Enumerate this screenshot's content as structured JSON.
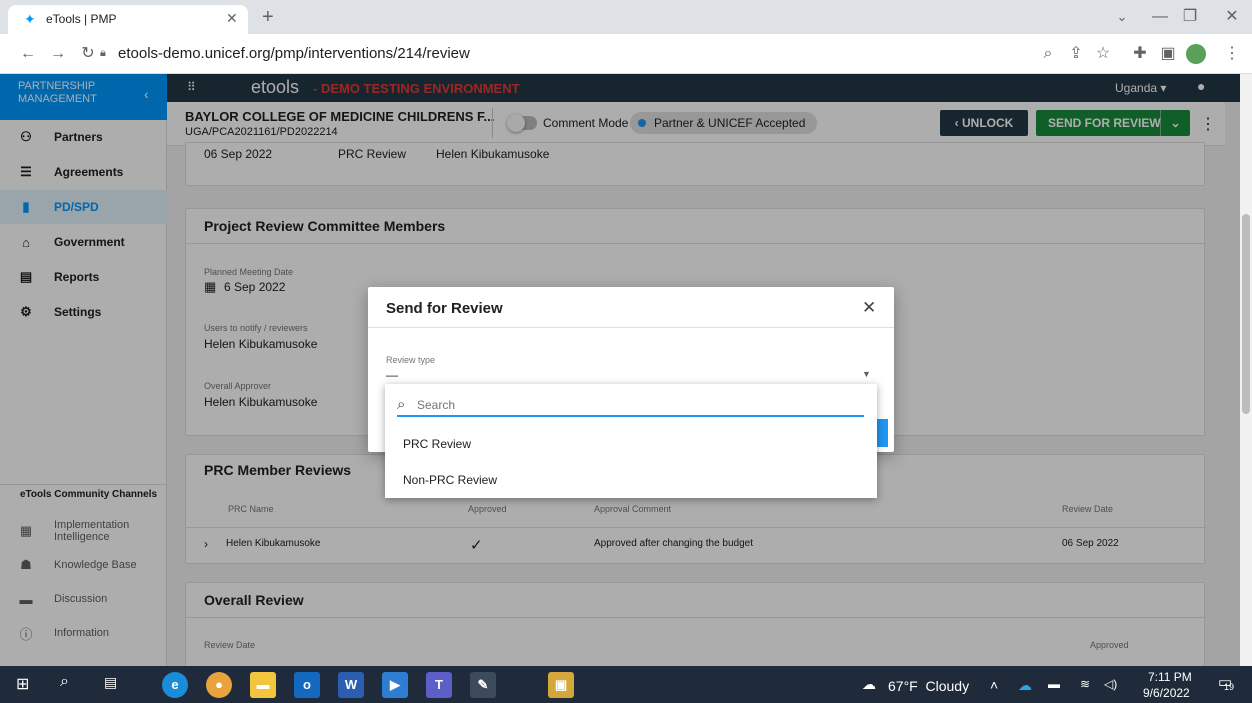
{
  "browser": {
    "tab_title": "eTools | PMP",
    "url": "etools-demo.unicef.org/pmp/interventions/214/review",
    "new_tab_glyph": "+"
  },
  "app": {
    "logo_text": "etools",
    "env_label": "- DEMO TESTING ENVIRONMENT",
    "country": "Uganda",
    "sidebar_title": "PARTNERSHIP MANAGEMENT",
    "nav": [
      {
        "label": "Partners",
        "icon": "people-icon"
      },
      {
        "label": "Agreements",
        "icon": "list-check-icon"
      },
      {
        "label": "PD/SPD",
        "icon": "document-icon"
      },
      {
        "label": "Government",
        "icon": "bank-icon"
      },
      {
        "label": "Reports",
        "icon": "clipboard-icon"
      },
      {
        "label": "Settings",
        "icon": "gear-icon"
      }
    ],
    "community_title": "eTools Community Channels",
    "community": [
      {
        "label": "Implementation Intelligence"
      },
      {
        "label": "Knowledge Base"
      },
      {
        "label": "Discussion"
      },
      {
        "label": "Information"
      }
    ]
  },
  "header": {
    "partner_name": "BAYLOR COLLEGE OF MEDICINE CHILDRENS F...",
    "reference": "UGA/PCA2021161/PD2022214",
    "comment_mode": "Comment Mode",
    "status": "Partner & UNICEF Accepted",
    "unlock": "UNLOCK",
    "send_for_review": "SEND FOR REVIEW"
  },
  "review_row": {
    "date": "06 Sep 2022",
    "type": "PRC Review",
    "person": "Helen Kibukamusoke"
  },
  "prc_members": {
    "title": "Project Review Committee Members",
    "meeting_label": "Planned Meeting Date",
    "meeting_date": "6 Sep 2022",
    "notify_label": "Users to notify / reviewers",
    "notify_value": "Helen Kibukamusoke",
    "approver_label": "Overall Approver",
    "approver_value": "Helen Kibukamusoke"
  },
  "prc_reviews": {
    "title": "PRC Member Reviews",
    "columns": [
      "PRC Name",
      "Approved",
      "Approval Comment",
      "Review Date"
    ],
    "row": {
      "name": "Helen Kibukamusoke",
      "approved": "✓",
      "comment": "Approved after changing the budget",
      "date": "06 Sep 2022"
    }
  },
  "overall_review": {
    "title": "Overall Review",
    "date_label": "Review Date",
    "approved_label": "Approved"
  },
  "dialog": {
    "title": "Send for Review",
    "field_label": "Review type",
    "field_value": "—",
    "search_placeholder": "Search",
    "options": [
      "PRC Review",
      "Non-PRC Review"
    ]
  },
  "taskbar": {
    "weather": "67°F  Cloudy",
    "time": "7:11 PM",
    "date": "9/6/2022",
    "notif_count": "19"
  },
  "colors": {
    "brand": "#0099ff",
    "topbar": "#233944",
    "send": "#1a8c3b",
    "unlock": "#233944",
    "accepted_dot": "#2196f3"
  }
}
